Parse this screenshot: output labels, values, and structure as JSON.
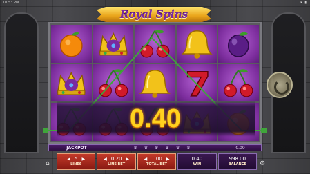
{
  "status": {
    "time": "10:53 PM",
    "right": "▾ ▮"
  },
  "logo": {
    "text": "Royal Spins"
  },
  "reels": [
    [
      "orange",
      "crown",
      "cherries"
    ],
    [
      "crown",
      "cherries",
      "cherries"
    ],
    [
      "cherries",
      "bell",
      "cherries"
    ],
    [
      "bell",
      "seven",
      "crown"
    ],
    [
      "plum",
      "cherries",
      "orange"
    ]
  ],
  "win": {
    "amount": "0.40"
  },
  "jackpot": {
    "label": "JACKPOT",
    "value": "0.00"
  },
  "bet": {
    "lines": {
      "value": "5",
      "label": "LINES"
    },
    "line_bet": {
      "value": "0.20",
      "label": "LINE BET"
    },
    "total_bet": {
      "value": "1.00",
      "label": "TOTAL BET"
    },
    "win": {
      "value": "0.40",
      "label": "WIN"
    },
    "balance": {
      "value": "998.00",
      "label": "BALANCE"
    }
  },
  "colors": {
    "reel_bg": "#7d2e9e",
    "win_text": "#ffd21f",
    "payline": "#3fa63a",
    "bet_box": "#c23a2a"
  },
  "icons": {
    "home": "home-icon",
    "spin": "spin-icon",
    "settings": "gear-icon"
  }
}
